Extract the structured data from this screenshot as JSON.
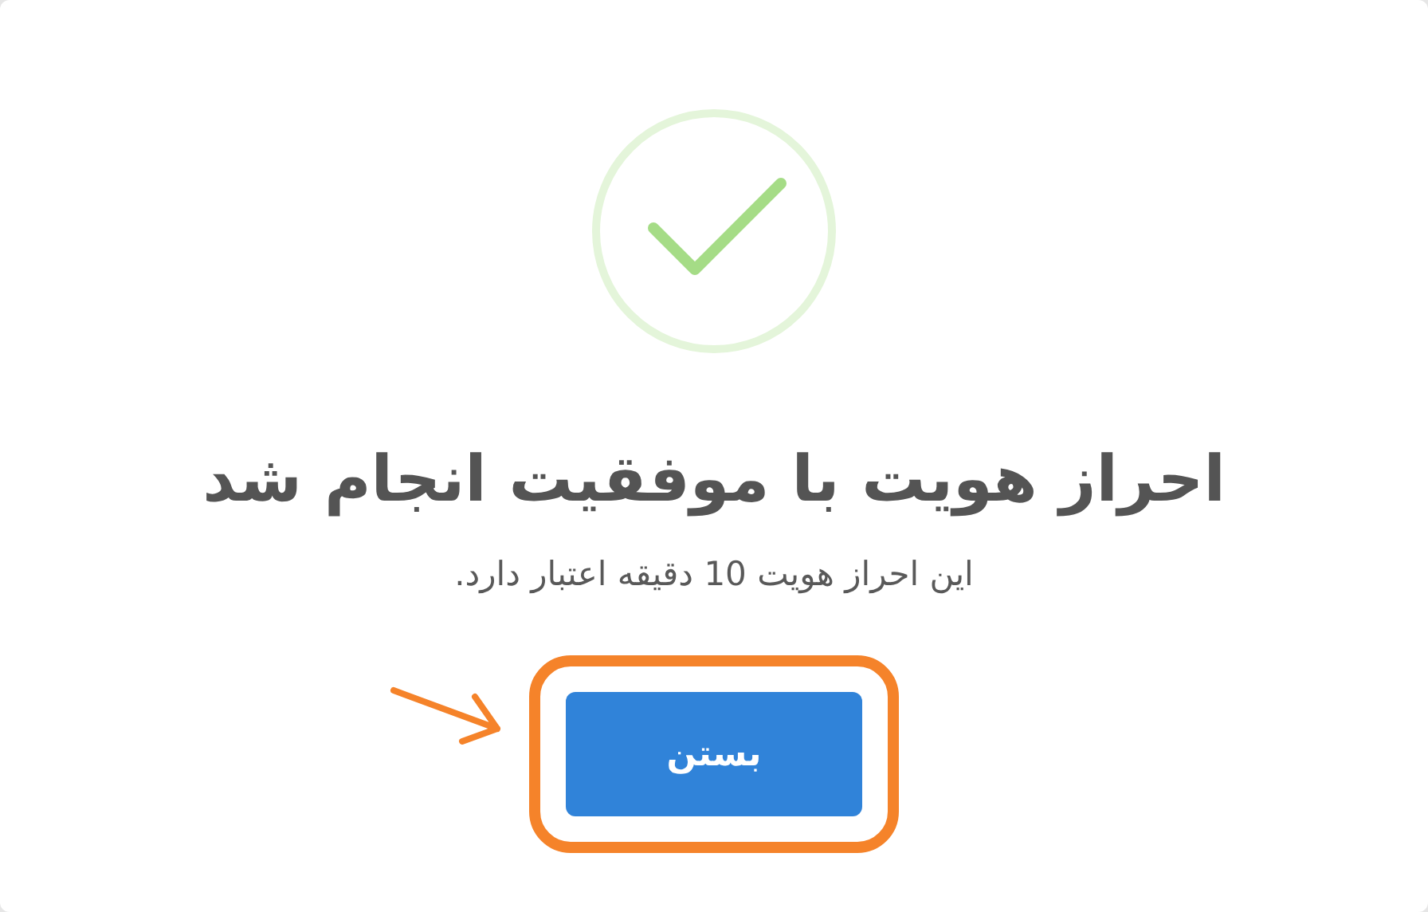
{
  "dialog": {
    "kind": "success",
    "title": "احراز هویت با موفقیت انجام شد",
    "message": "این احراز هویت 10 دقیقه اعتبار دارد.",
    "buttons": [
      {
        "label": "بستن",
        "highlighted": true
      }
    ]
  }
}
